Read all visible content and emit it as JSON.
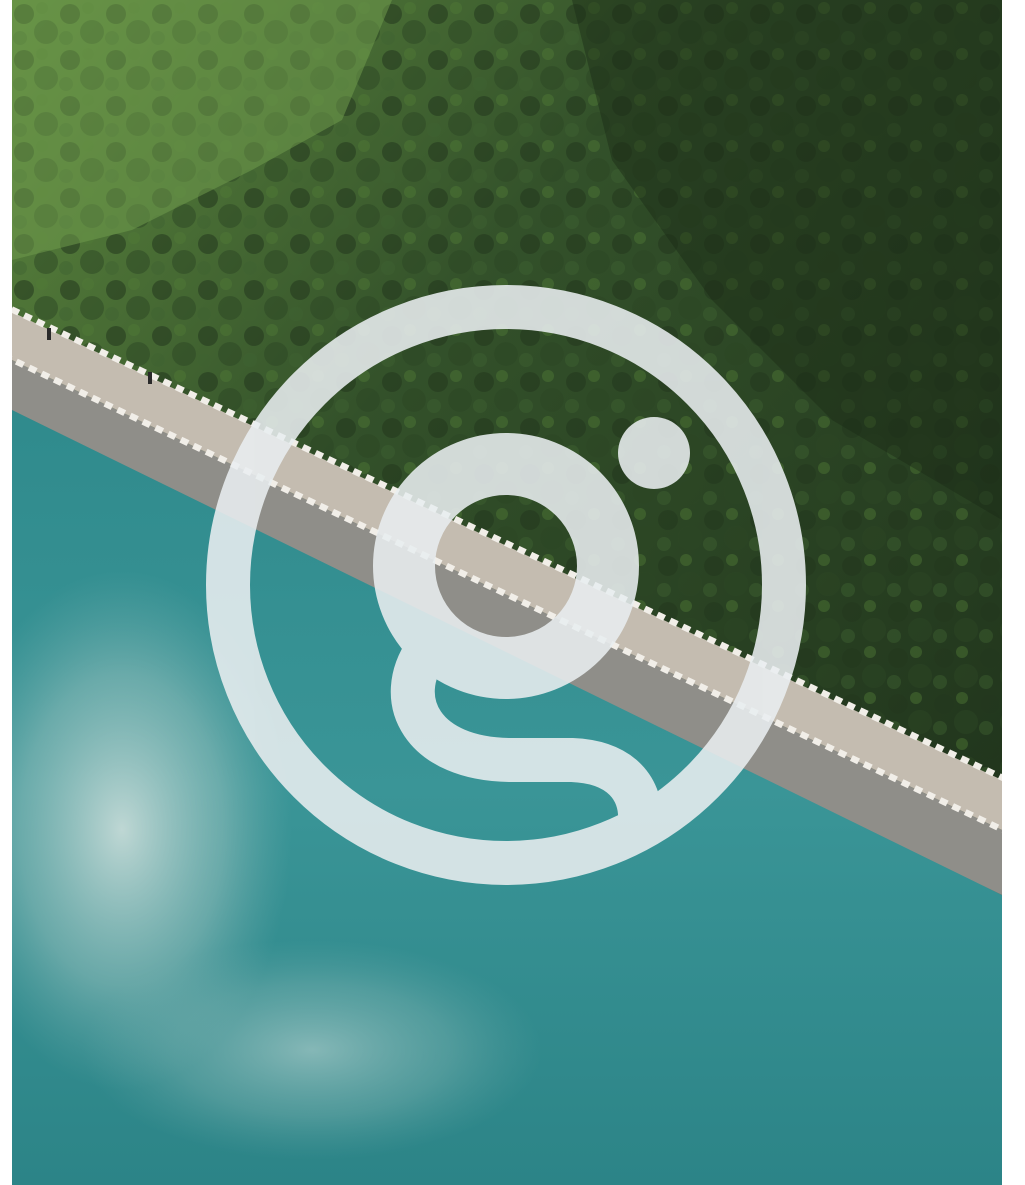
{
  "scene": {
    "subject": "aerial-photo-dam-bridge-over-reservoir",
    "logo_icon": "letter-g-in-circle-logo-icon"
  },
  "colors": {
    "forest_dark": "#1c2e18",
    "forest_mid": "#2f4a24",
    "forest_light": "#6f9a4c",
    "water_deep": "#2f8a8e",
    "water_light": "#5aa7aa",
    "cloud_reflection": "#c9dcd8",
    "bridge_deck": "#c7bfb4",
    "bridge_wall": "#8c8b87",
    "logo": "#e9eef0"
  }
}
